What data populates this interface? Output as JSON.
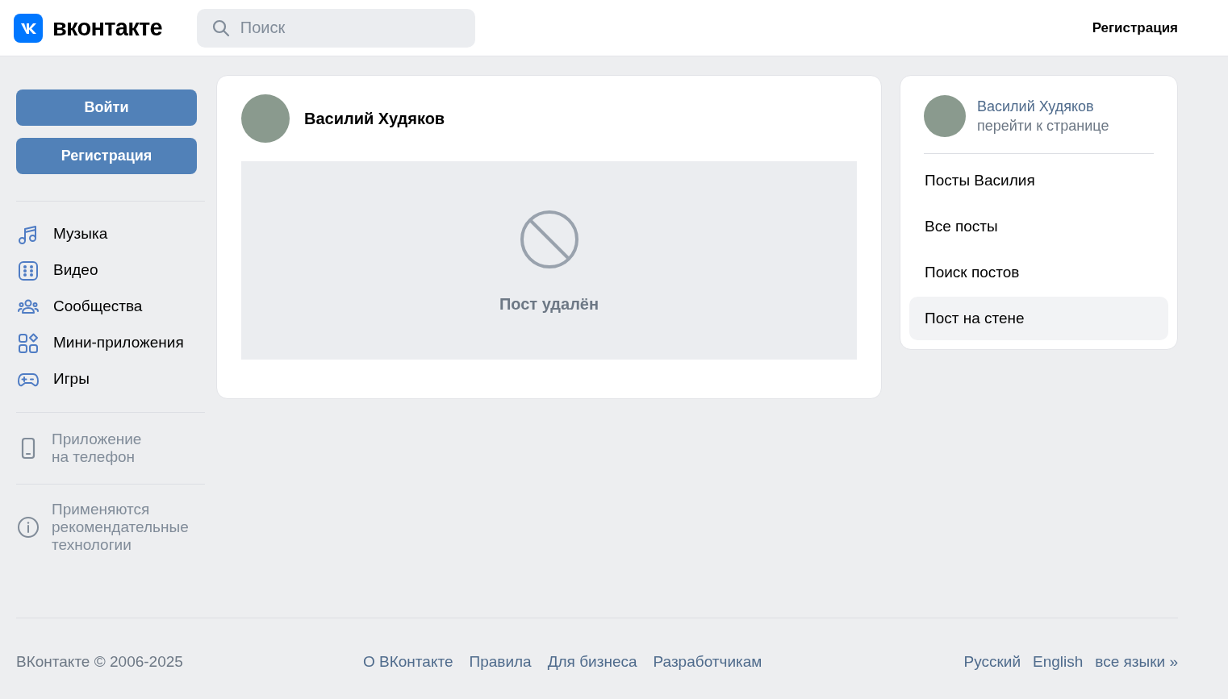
{
  "header": {
    "logo_text": "вконтакте",
    "search": {
      "placeholder": "Поиск"
    },
    "register_link": "Регистрация"
  },
  "sidebar": {
    "buttons": [
      "Войти",
      "Регистрация"
    ],
    "nav": [
      "Музыка",
      "Видео",
      "Сообщества",
      "Мини-приложения",
      "Игры"
    ],
    "app_promo": "Приложение\nна телефон",
    "recommendations": "Применяются\nрекомендательные\nтехнологии"
  },
  "post": {
    "author": "Василий Худяков",
    "deleted_message": "Пост удалён"
  },
  "profile_menu": {
    "name": "Василий Худяков",
    "link": "перейти к странице",
    "items": [
      {
        "label": "Посты Василия",
        "selected": false
      },
      {
        "label": "Все посты",
        "selected": false
      },
      {
        "label": "Поиск постов",
        "selected": false
      },
      {
        "label": "Пост на стене",
        "selected": true
      }
    ]
  },
  "footer": {
    "copyright": "ВКонтакте © 2006-2025",
    "links": [
      "О ВКонтакте",
      "Правила",
      "Для бизнеса",
      "Разработчикам"
    ],
    "languages": [
      "Русский",
      "English",
      "все языки »"
    ]
  }
}
